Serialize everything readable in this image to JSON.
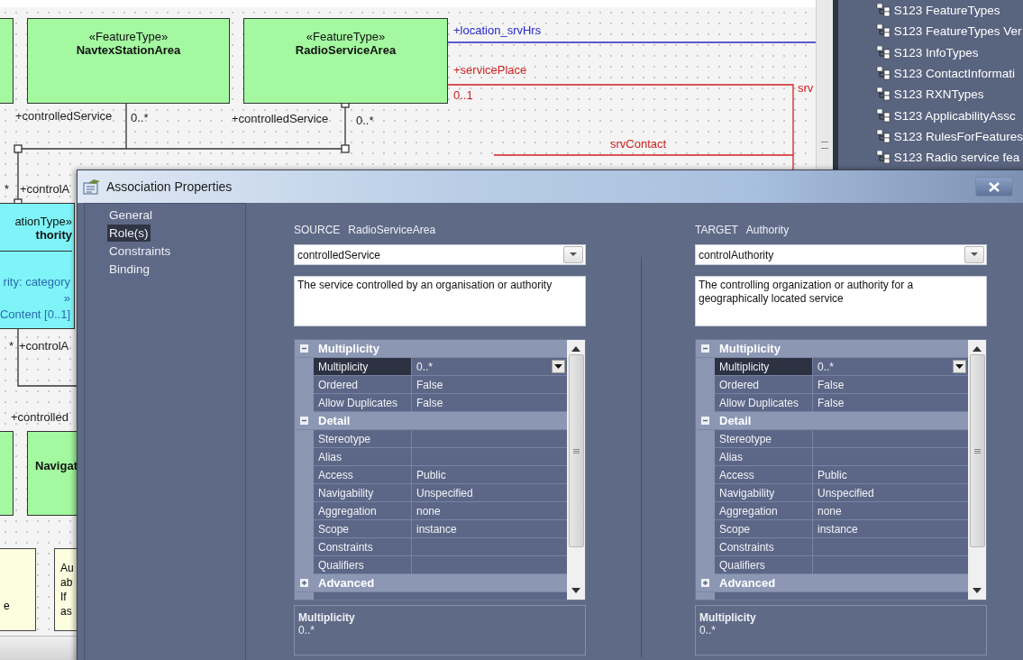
{
  "diagram": {
    "classes": [
      {
        "kind": "feature"
      },
      {
        "kind": "feature",
        "stereotype": "«FeatureType»",
        "name": "NavtexStationArea"
      },
      {
        "kind": "feature",
        "stereotype": "«FeatureType»",
        "name": "RadioServiceArea"
      },
      {
        "kind": "information",
        "stereotype": "ationType»",
        "name": "thority",
        "attributes": [
          "rity: category",
          "»",
          "Content [0..1]"
        ]
      },
      {
        "kind": "feature"
      },
      {
        "kind": "feature",
        "name": "Navigat"
      }
    ],
    "labels": [
      {
        "text": "+location_srvHrs",
        "color": "#2626c8"
      },
      {
        "text": "+servicePlace",
        "color": "#d02020"
      },
      {
        "text": "0..1",
        "color": "#d02020"
      },
      {
        "text": "srv",
        "color": "#d02020"
      },
      {
        "text": "srvContact",
        "color": "#d02020"
      },
      {
        "text": "+controlledService"
      },
      {
        "text": "0..*"
      },
      {
        "text": "+controlledService"
      },
      {
        "text": "0..*"
      },
      {
        "text": "*"
      },
      {
        "text": "+controlA"
      },
      {
        "text": "*"
      },
      {
        "text": "+controlA"
      },
      {
        "text": "+controlled"
      }
    ],
    "notes": [
      {
        "lines": [
          "e"
        ]
      },
      {
        "lines": [
          "Au",
          "ab",
          "If",
          "as"
        ]
      }
    ]
  },
  "project_browser": {
    "items": [
      "S123 FeatureTypes",
      "S123 FeatureTypes Ver",
      "S123 InfoTypes",
      "S123 ContactInformati",
      "S123 RXNTypes",
      "S123 ApplicabilityAssc",
      "S123 RulesForFeatures",
      "S123 Radio service fea"
    ]
  },
  "dialog": {
    "title": "Association Properties",
    "nav": [
      {
        "label": "General",
        "selected": false
      },
      {
        "label": "Role(s)",
        "selected": true
      },
      {
        "label": "Constraints",
        "selected": false
      },
      {
        "label": "Binding",
        "selected": false
      }
    ],
    "ends": [
      {
        "end": "SOURCE",
        "class_name": "RadioServiceArea",
        "role": "controlledService",
        "notes": "The service controlled by an organisation or authority",
        "sections": [
          {
            "title": "Multiplicity",
            "expanded": true,
            "rows": [
              {
                "label": "Multiplicity",
                "value": "0..*",
                "selected": true
              },
              {
                "label": "Ordered",
                "value": "False",
                "selected": false
              },
              {
                "label": "Allow Duplicates",
                "value": "False",
                "selected": false
              }
            ]
          },
          {
            "title": "Detail",
            "expanded": true,
            "rows": [
              {
                "label": "Stereotype",
                "selected": false
              },
              {
                "label": "Alias",
                "selected": false
              },
              {
                "label": "Access",
                "value": "Public",
                "selected": false
              },
              {
                "label": "Navigability",
                "value": "Unspecified",
                "selected": false
              },
              {
                "label": "Aggregation",
                "value": "none",
                "selected": false
              },
              {
                "label": "Scope",
                "value": "instance",
                "selected": false
              },
              {
                "label": "Constraints",
                "selected": false
              },
              {
                "label": "Qualifiers",
                "selected": false
              }
            ]
          },
          {
            "title": "Advanced",
            "expanded": false
          }
        ],
        "description": {
          "title": "Multiplicity",
          "value": "0..*"
        }
      },
      {
        "end": "TARGET",
        "class_name": "Authority",
        "role": "controlAuthority",
        "notes": "The controlling organization or authority for a geographically located service",
        "sections": [
          {
            "title": "Multiplicity",
            "expanded": true,
            "rows": [
              {
                "label": "Multiplicity",
                "value": "0..*",
                "selected": true
              },
              {
                "label": "Ordered",
                "value": "False",
                "selected": false
              },
              {
                "label": "Allow Duplicates",
                "value": "False",
                "selected": false
              }
            ]
          },
          {
            "title": "Detail",
            "expanded": true,
            "rows": [
              {
                "label": "Stereotype",
                "selected": false
              },
              {
                "label": "Alias",
                "selected": false
              },
              {
                "label": "Access",
                "value": "Public",
                "selected": false
              },
              {
                "label": "Navigability",
                "value": "Unspecified",
                "selected": false
              },
              {
                "label": "Aggregation",
                "value": "none",
                "selected": false
              },
              {
                "label": "Scope",
                "value": "instance",
                "selected": false
              },
              {
                "label": "Constraints",
                "selected": false
              },
              {
                "label": "Qualifiers",
                "selected": false
              }
            ]
          },
          {
            "title": "Advanced",
            "expanded": false
          }
        ],
        "description": {
          "title": "Multiplicity",
          "value": "0..*"
        }
      }
    ]
  }
}
